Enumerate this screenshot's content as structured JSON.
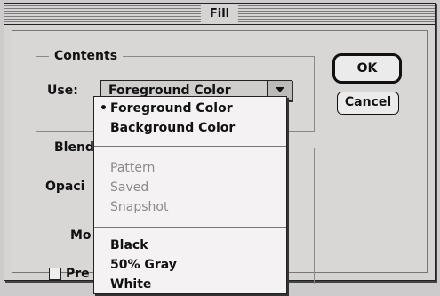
{
  "window": {
    "title": "Fill"
  },
  "contents": {
    "legend": "Contents",
    "use_label": "Use:",
    "selected": "Foreground Color"
  },
  "blending": {
    "legend": "Blend",
    "opacity_label": "Opaci",
    "mode_label": "Mo",
    "preserve_label": "Pre"
  },
  "buttons": {
    "ok": "OK",
    "cancel": "Cancel"
  },
  "menu": {
    "group1": [
      "Foreground Color",
      "Background Color"
    ],
    "group2": [
      "Pattern",
      "Saved",
      "Snapshot"
    ],
    "group3": [
      "Black",
      "50% Gray",
      "White"
    ],
    "checked": "Foreground Color"
  }
}
